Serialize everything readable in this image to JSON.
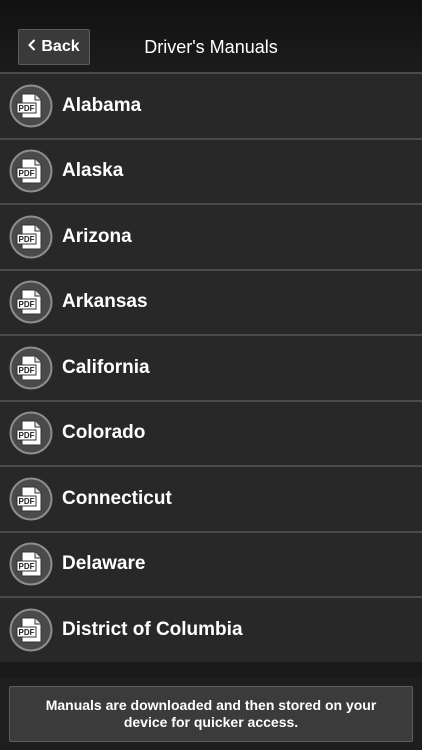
{
  "header": {
    "back_label": "Back",
    "title": "Driver's Manuals"
  },
  "icon_label": "PDF",
  "states": [
    {
      "label": "Alabama"
    },
    {
      "label": "Alaska"
    },
    {
      "label": "Arizona"
    },
    {
      "label": "Arkansas"
    },
    {
      "label": "California"
    },
    {
      "label": "Colorado"
    },
    {
      "label": "Connecticut"
    },
    {
      "label": "Delaware"
    },
    {
      "label": "District of Columbia"
    }
  ],
  "footer": {
    "notice": "Manuals are downloaded and then stored on your device for quicker access."
  }
}
